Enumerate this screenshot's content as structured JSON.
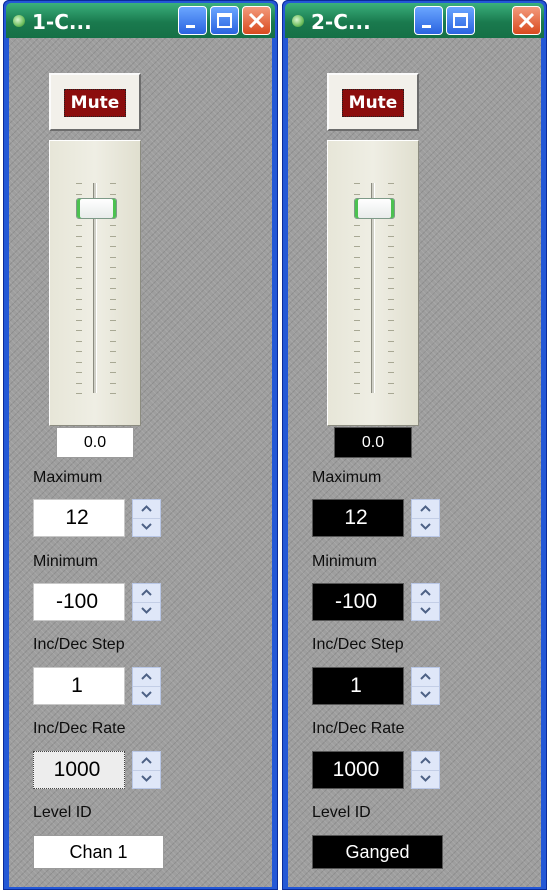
{
  "windows": [
    {
      "title": "1-C...",
      "mute_label": "Mute",
      "fader_value": "0.0",
      "maximum_label": "Maximum",
      "maximum_value": "12",
      "minimum_label": "Minimum",
      "minimum_value": "-100",
      "step_label": "Inc/Dec Step",
      "step_value": "1",
      "rate_label": "Inc/Dec Rate",
      "rate_value": "1000",
      "level_id_label": "Level ID",
      "level_id_value": "Chan  1",
      "fader_level_fraction": 0.94,
      "theme": "light"
    },
    {
      "title": "2-C...",
      "mute_label": "Mute",
      "fader_value": "0.0",
      "maximum_label": "Maximum",
      "maximum_value": "12",
      "minimum_label": "Minimum",
      "minimum_value": "-100",
      "step_label": "Inc/Dec Step",
      "step_value": "1",
      "rate_label": "Inc/Dec Rate",
      "rate_value": "1000",
      "level_id_label": "Level ID",
      "level_id_value": "Ganged",
      "fader_level_fraction": 0.94,
      "theme": "dark"
    }
  ],
  "colors": {
    "title_bar": "#1a7a4e",
    "window_frame": "#2458d6",
    "mute_active": "#8b0d0d",
    "thumb_accent": "#4cc150"
  },
  "icons": {
    "title": "control-panel-icon",
    "minimize": "minimize-icon",
    "maximize": "maximize-icon",
    "close": "close-icon",
    "spin_up": "chevron-up-icon",
    "spin_down": "chevron-down-icon"
  }
}
